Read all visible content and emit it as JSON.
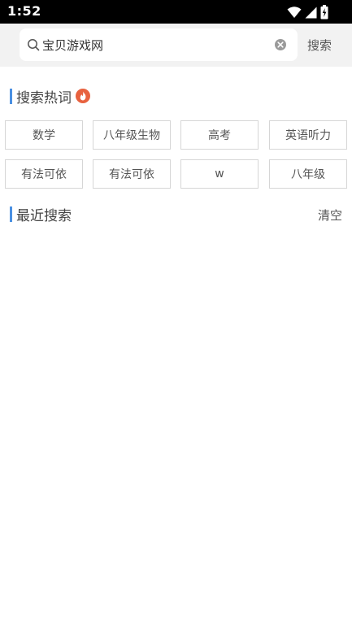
{
  "status_bar": {
    "time": "1:52",
    "icons": [
      "wifi-icon",
      "signal-icon",
      "battery-charging-icon"
    ]
  },
  "search": {
    "value": "宝贝游戏网",
    "button_label": "搜索"
  },
  "hot_section": {
    "title": "搜索热词",
    "tags": [
      "数学",
      "八年级生物",
      "高考",
      "英语听力",
      "有法可依",
      "有法可依",
      "w",
      "八年级"
    ]
  },
  "recent_section": {
    "title": "最近搜索",
    "clear_label": "清空"
  },
  "colors": {
    "accent": "#4a90e2",
    "fire": "#e8623f",
    "status_bar": "#000000",
    "search_area": "#f2f2f2"
  }
}
